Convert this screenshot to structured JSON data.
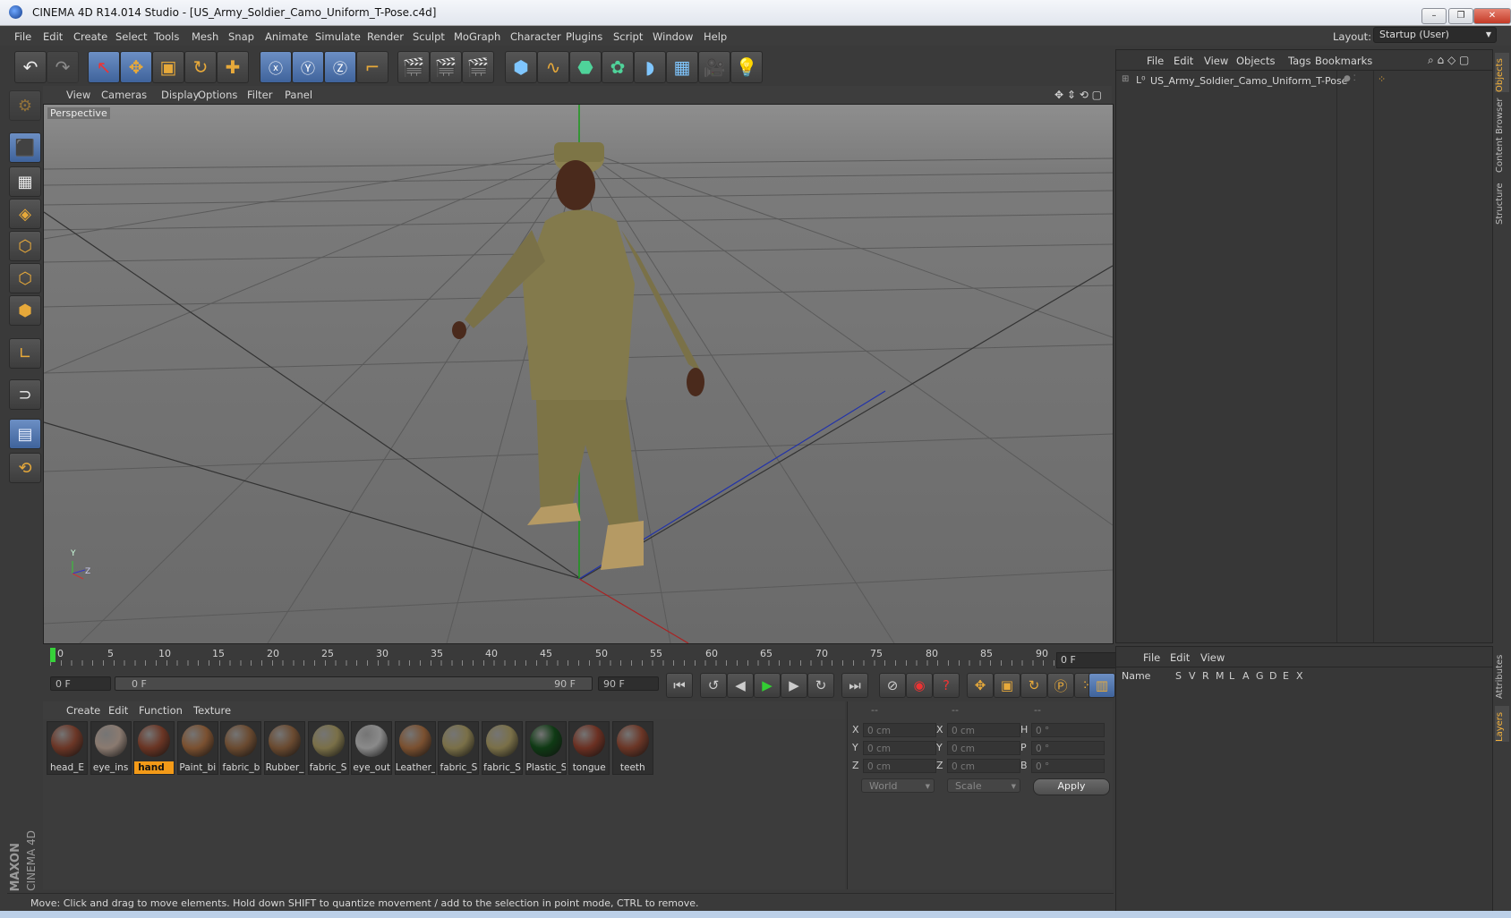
{
  "window": {
    "title": "CINEMA 4D R14.014 Studio - [US_Army_Soldier_Camo_Uniform_T-Pose.c4d]"
  },
  "menubar": {
    "items": [
      "File",
      "Edit",
      "Create",
      "Select",
      "Tools",
      "Mesh",
      "Snap",
      "Animate",
      "Simulate",
      "Render",
      "Sculpt",
      "MoGraph",
      "Character",
      "Plugins",
      "Script",
      "Window",
      "Help"
    ],
    "layout_label": "Layout:",
    "layout_value": "Startup (User)"
  },
  "viewport": {
    "menu": [
      "View",
      "Cameras",
      "Display",
      "Options",
      "Filter",
      "Panel"
    ],
    "camera_label": "Perspective",
    "axis": {
      "y": "Y",
      "z": "Z"
    }
  },
  "timeline": {
    "ticks": [
      "0",
      "5",
      "10",
      "15",
      "20",
      "25",
      "30",
      "35",
      "40",
      "45",
      "50",
      "55",
      "60",
      "65",
      "70",
      "75",
      "80",
      "85",
      "90"
    ],
    "current_frame": "0 F",
    "start_field": "0 F",
    "range_start": "0 F",
    "range_end": "90 F",
    "end_field": "90 F"
  },
  "materials": {
    "menu": [
      "Create",
      "Edit",
      "Function",
      "Texture"
    ],
    "items": [
      {
        "label": "head_E",
        "color": "#6b3626"
      },
      {
        "label": "eye_ins",
        "color": "#8a7a70"
      },
      {
        "label": "hand",
        "color": "#6a3524"
      },
      {
        "label": "Paint_bi",
        "color": "#7a5030"
      },
      {
        "label": "fabric_b",
        "color": "#6a4a30"
      },
      {
        "label": "Rubber_",
        "color": "#6a4a30"
      },
      {
        "label": "fabric_S",
        "color": "#7a7048"
      },
      {
        "label": "eye_out",
        "color": "#8a8a8a"
      },
      {
        "label": "Leather_",
        "color": "#7a5030"
      },
      {
        "label": "fabric_S",
        "color": "#7a7048"
      },
      {
        "label": "fabric_S",
        "color": "#7a7048"
      },
      {
        "label": "Plastic_S",
        "color": "#0f3a14"
      },
      {
        "label": "tongue",
        "color": "#6b3022"
      },
      {
        "label": "teeth",
        "color": "#6b3626"
      }
    ],
    "selected_index": 2
  },
  "coordinates": {
    "headers": [
      "--",
      "--",
      "--"
    ],
    "rows": [
      {
        "l1": "X",
        "v1": "0 cm",
        "l2": "X",
        "v2": "0 cm",
        "l3": "H",
        "v3": "0 °"
      },
      {
        "l1": "Y",
        "v1": "0 cm",
        "l2": "Y",
        "v2": "0 cm",
        "l3": "P",
        "v3": "0 °"
      },
      {
        "l1": "Z",
        "v1": "0 cm",
        "l2": "Z",
        "v2": "0 cm",
        "l3": "B",
        "v3": "0 °"
      }
    ],
    "world": "World",
    "scale": "Scale",
    "apply": "Apply"
  },
  "status": {
    "text": "Move: Click and drag to move elements. Hold down SHIFT to quantize movement / add to the selection in point mode, CTRL to remove."
  },
  "objects_panel": {
    "menu": [
      "File",
      "Edit",
      "View",
      "Objects",
      "Tags",
      "Bookmarks"
    ],
    "object_name": "US_Army_Soldier_Camo_Uniform_T-Pose"
  },
  "layers_panel": {
    "menu": [
      "File",
      "Edit",
      "View"
    ],
    "name_col": "Name",
    "flags": [
      "S",
      "V",
      "R",
      "M",
      "L",
      "A",
      "G",
      "D",
      "E",
      "X"
    ]
  },
  "side_tabs": {
    "objects": "Objects",
    "content_browser": "Content Browser",
    "structure": "Structure",
    "attributes": "Attributes",
    "layers": "Layers"
  },
  "brand": {
    "maxon": "MAXON",
    "cinema": "CINEMA 4D"
  }
}
